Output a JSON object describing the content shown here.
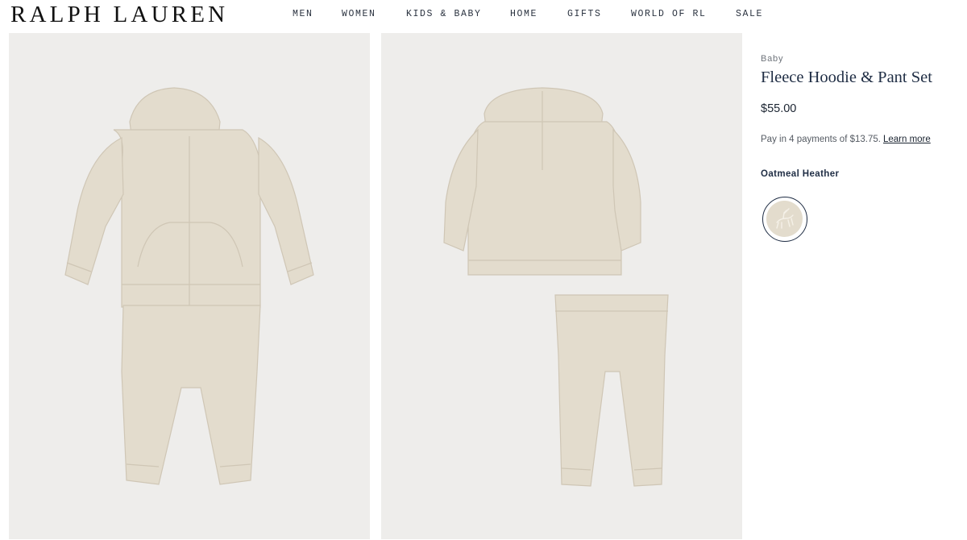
{
  "header": {
    "logo": "RALPH LAUREN",
    "nav": [
      "MEN",
      "WOMEN",
      "KIDS & BABY",
      "HOME",
      "GIFTS",
      "WORLD OF RL",
      "SALE"
    ]
  },
  "gallery": {
    "background": "#eeedeb",
    "garment_color": "#e3dccd"
  },
  "product": {
    "breadcrumb": "Baby",
    "title": "Fleece Hoodie & Pant Set",
    "price": "$55.00",
    "payments_text": "Pay in 4 payments of $13.75.",
    "learn_more": "Learn more",
    "color_name": "Oatmeal Heather",
    "swatch_icon": "polo-pony-icon"
  },
  "colors": {
    "text_navy": "#1f2d44"
  }
}
